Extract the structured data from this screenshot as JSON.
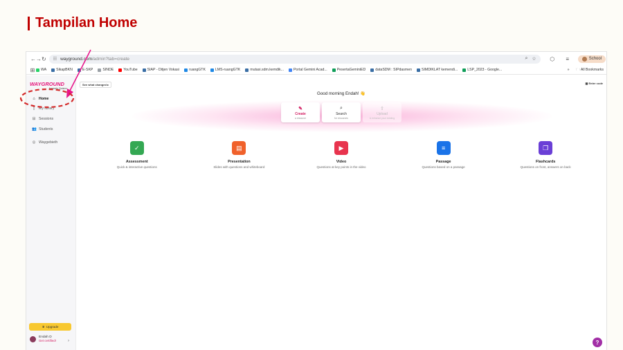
{
  "slide": {
    "title": "Tampilan Home"
  },
  "browser": {
    "url_host": "wayground.com",
    "url_path": "/admin?tab=create",
    "profile_label": "School",
    "bookmarks": [
      {
        "label": "WA",
        "color": "#25d366"
      },
      {
        "label": "SikapBKN",
        "color": "#3a6ea5"
      },
      {
        "label": "E-SKP",
        "color": "#3a6ea5"
      },
      {
        "label": "SINDE",
        "color": "#9aa0a6"
      },
      {
        "label": "YouTube",
        "color": "#ff0000"
      },
      {
        "label": "SIAP - Ditjen Vokasi",
        "color": "#3a6ea5"
      },
      {
        "label": "ruangGTK",
        "color": "#1e88e5"
      },
      {
        "label": "LMS-ruangGTK",
        "color": "#1e88e5"
      },
      {
        "label": "mutasi.sdm.kemdik...",
        "color": "#3a6ea5"
      },
      {
        "label": "Portal Gemini Acad...",
        "color": "#4285f4"
      },
      {
        "label": "PesertaGeminiED",
        "color": "#0f9d58"
      },
      {
        "label": "dataSDM : SIPdasmen",
        "color": "#3a6ea5"
      },
      {
        "label": "SIMDIKLAT kemendi...",
        "color": "#3a6ea5"
      },
      {
        "label": "LSP_2023 - Google...",
        "color": "#0f9d58"
      }
    ],
    "bookmarks_overflow": "»",
    "all_bookmarks": "All Bookmarks"
  },
  "sidebar": {
    "logo": "WAYGROUND",
    "logo_sub": "formerly Quizizz",
    "items": [
      {
        "label": "Home",
        "icon": "home-icon",
        "glyph": "⌂"
      },
      {
        "label": "My library",
        "icon": "library-icon",
        "glyph": "▯"
      },
      {
        "label": "Sessions",
        "icon": "sessions-icon",
        "glyph": "⊟"
      },
      {
        "label": "Students",
        "icon": "students-icon",
        "glyph": "👥"
      },
      {
        "label": "Waygebieth",
        "icon": "external-link-icon",
        "glyph": "◎"
      }
    ],
    "upgrade_label": "Upgrade",
    "user_name": "Endah D",
    "user_status": "Get certified!"
  },
  "main": {
    "see_changed": "See what changed ▸",
    "enter_code": "Enter code",
    "greeting": "Good morning Endah! 👋",
    "tabs": [
      {
        "label": "Create",
        "sub": "a resource",
        "glyph": "✎"
      },
      {
        "label": "Search",
        "sub": "for resources",
        "glyph": "⌕"
      },
      {
        "label": "Upload",
        "sub": "& enhance your existing",
        "glyph": "⇪"
      }
    ],
    "types": [
      {
        "label": "Assessment",
        "desc": "Quick & interactive questions",
        "color": "#34a853",
        "glyph": "✓"
      },
      {
        "label": "Presentation",
        "desc": "Slides with questions and whiteboard",
        "color": "#f0612b",
        "glyph": "▤"
      },
      {
        "label": "Video",
        "desc": "Questions at key points in the video",
        "color": "#e8344e",
        "glyph": "▶"
      },
      {
        "label": "Passage",
        "desc": "Questions based on a passage",
        "color": "#1a73e8",
        "glyph": "≡"
      },
      {
        "label": "Flashcards",
        "desc": "Questions on front, answers on back",
        "color": "#6a3fd6",
        "glyph": "❐"
      }
    ]
  },
  "colors": {
    "annotation": "#e8158a",
    "brand": "#e5147a",
    "title": "#c00000"
  }
}
